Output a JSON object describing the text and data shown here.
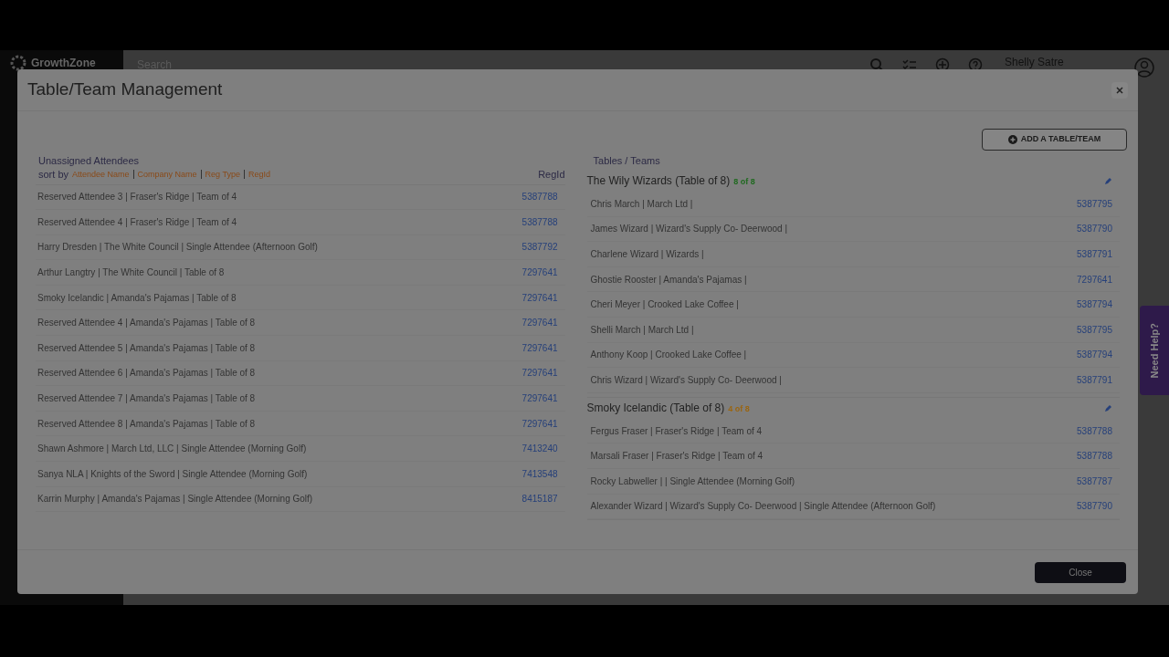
{
  "app": {
    "logo": "GrowthZone",
    "search": {
      "placeholder": "Search"
    },
    "user": "Shelly Satre",
    "help_tab": "Need Help?"
  },
  "modal": {
    "title": "Table/Team Management",
    "add_button": "ADD A TABLE/TEAM",
    "unassigned": {
      "heading": "Unassigned Attendees",
      "sort_label": "sort by",
      "sort_options": [
        "Attendee Name",
        "Company Name",
        "Reg Type",
        "RegId"
      ],
      "column_header": "RegId",
      "rows": [
        {
          "text": "Reserved Attendee 3 | Fraser's Ridge | Team of 4",
          "regid": "5387788"
        },
        {
          "text": "Reserved Attendee 4 | Fraser's Ridge | Team of 4",
          "regid": "5387788"
        },
        {
          "text": "Harry Dresden | The White Council | Single Attendee (Afternoon Golf)",
          "regid": "5387792"
        },
        {
          "text": "Arthur Langtry | The White Council | Table of 8",
          "regid": "7297641"
        },
        {
          "text": "Smoky Icelandic | Amanda's Pajamas | Table of 8",
          "regid": "7297641"
        },
        {
          "text": "Reserved Attendee 4 | Amanda's Pajamas | Table of 8",
          "regid": "7297641"
        },
        {
          "text": "Reserved Attendee 5 | Amanda's Pajamas | Table of 8",
          "regid": "7297641"
        },
        {
          "text": "Reserved Attendee 6 | Amanda's Pajamas | Table of 8",
          "regid": "7297641"
        },
        {
          "text": "Reserved Attendee 7 | Amanda's Pajamas | Table of 8",
          "regid": "7297641"
        },
        {
          "text": "Reserved Attendee 8 | Amanda's Pajamas | Table of 8",
          "regid": "7297641"
        },
        {
          "text": "Shawn Ashmore | March Ltd, LLC | Single Attendee (Morning Golf)",
          "regid": "7413240"
        },
        {
          "text": "Sanya NLA | Knights of the Sword | Single Attendee (Morning Golf)",
          "regid": "7413548"
        },
        {
          "text": "Karrin Murphy | Amanda's Pajamas | Single Attendee (Morning Golf)",
          "regid": "8415187"
        }
      ]
    },
    "tables": {
      "heading": "Tables / Teams",
      "teams": [
        {
          "name": "The Wily Wizards (Table of 8)",
          "count": "8 of 8",
          "color": "#1f6a1f",
          "members": [
            {
              "text": "Chris March | March Ltd |",
              "regid": "5387795"
            },
            {
              "text": "James Wizard | Wizard's Supply Co- Deerwood |",
              "regid": "5387790"
            },
            {
              "text": "Charlene Wizard | Wizards |",
              "regid": "5387791"
            },
            {
              "text": "Ghostie Rooster | Amanda's Pajamas |",
              "regid": "7297641"
            },
            {
              "text": "Cheri Meyer | Crooked Lake Coffee |",
              "regid": "5387794"
            },
            {
              "text": "Shelli March | March Ltd |",
              "regid": "5387795"
            },
            {
              "text": "Anthony Koop | Crooked Lake Coffee |",
              "regid": "5387794"
            },
            {
              "text": "Chris Wizard | Wizard's Supply Co- Deerwood |",
              "regid": "5387791"
            }
          ]
        },
        {
          "name": "Smoky Icelandic (Table of 8)",
          "count": "4 of 8",
          "color": "#9a6510",
          "members": [
            {
              "text": "Fergus Fraser | Fraser's Ridge | Team of 4",
              "regid": "5387788"
            },
            {
              "text": "Marsali Fraser | Fraser's Ridge | Team of 4",
              "regid": "5387788"
            },
            {
              "text": "Rocky Labweller | | Single Attendee (Morning Golf)",
              "regid": "5387787"
            },
            {
              "text": "Alexander Wizard | Wizard's Supply Co- Deerwood | Single Attendee (Afternoon Golf)",
              "regid": "5387790"
            }
          ]
        }
      ]
    },
    "close_button": "Close"
  }
}
